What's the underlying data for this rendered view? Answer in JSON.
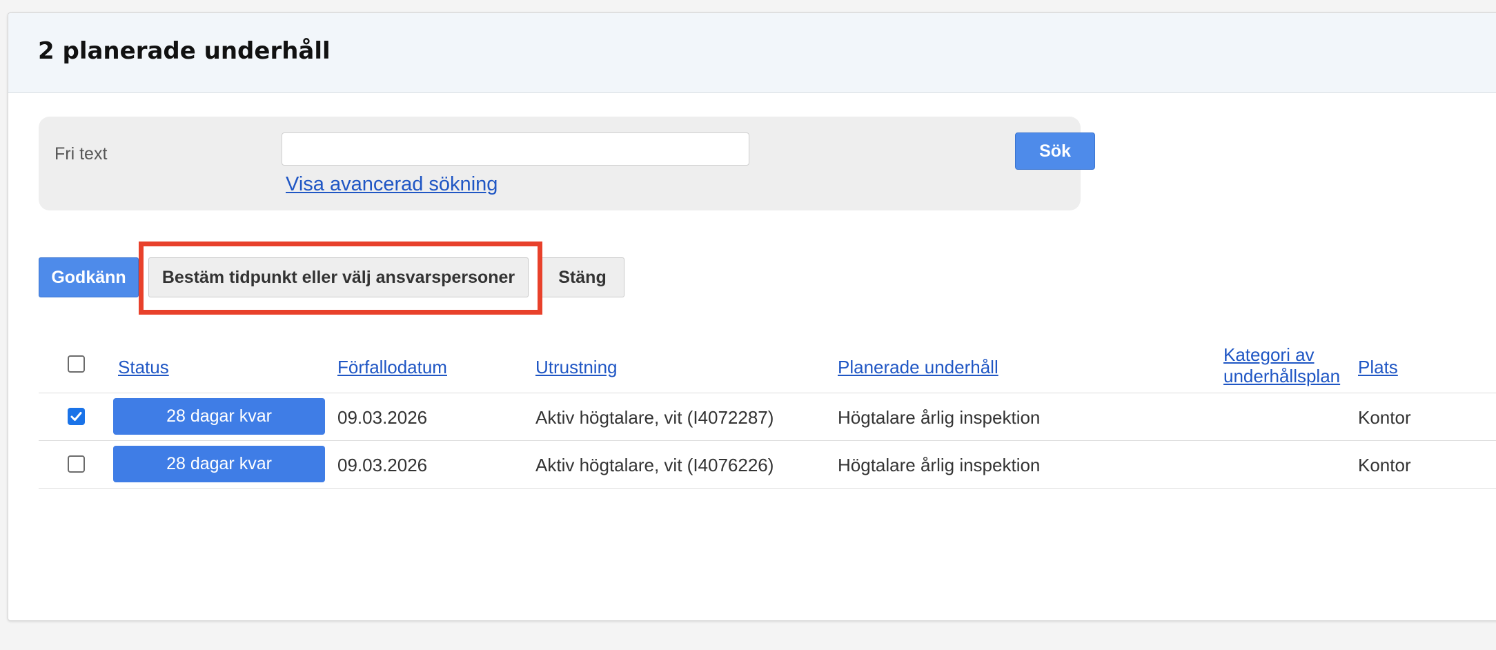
{
  "header": {
    "title": "2 planerade underhåll"
  },
  "search": {
    "label": "Fri text",
    "value": "",
    "placeholder": "",
    "button_label": "Sök",
    "advanced_link": "Visa avancerad sökning"
  },
  "toolbar": {
    "approve_label": "Godkänn",
    "schedule_label": "Bestäm tidpunkt eller välj ansvarspersoner",
    "close_label": "Stäng",
    "highlight_color": "#e8412b"
  },
  "table": {
    "columns": {
      "status": "Status",
      "due_date": "Förfallodatum",
      "equipment": "Utrustning",
      "planned": "Planerade underhåll",
      "category_line1": "Kategori av",
      "category_line2": "underhållsplan",
      "location": "Plats"
    },
    "select_all_checked": false,
    "rows": [
      {
        "checked": true,
        "status": "28 dagar kvar",
        "due_date": "09.03.2026",
        "equipment": "Aktiv högtalare, vit (I4072287)",
        "planned": "Högtalare årlig inspektion",
        "category": "",
        "location": "Kontor"
      },
      {
        "checked": false,
        "status": "28 dagar kvar",
        "due_date": "09.03.2026",
        "equipment": "Aktiv högtalare, vit (I4076226)",
        "planned": "Högtalare årlig inspektion",
        "category": "",
        "location": "Kontor"
      }
    ]
  },
  "colors": {
    "primary": "#4e8bea",
    "status_badge": "#3f7de6",
    "link": "#1f56c4",
    "checkbox_checked": "#1a73e8"
  },
  "icons": {
    "checkbox_check": "checkmark-icon"
  }
}
